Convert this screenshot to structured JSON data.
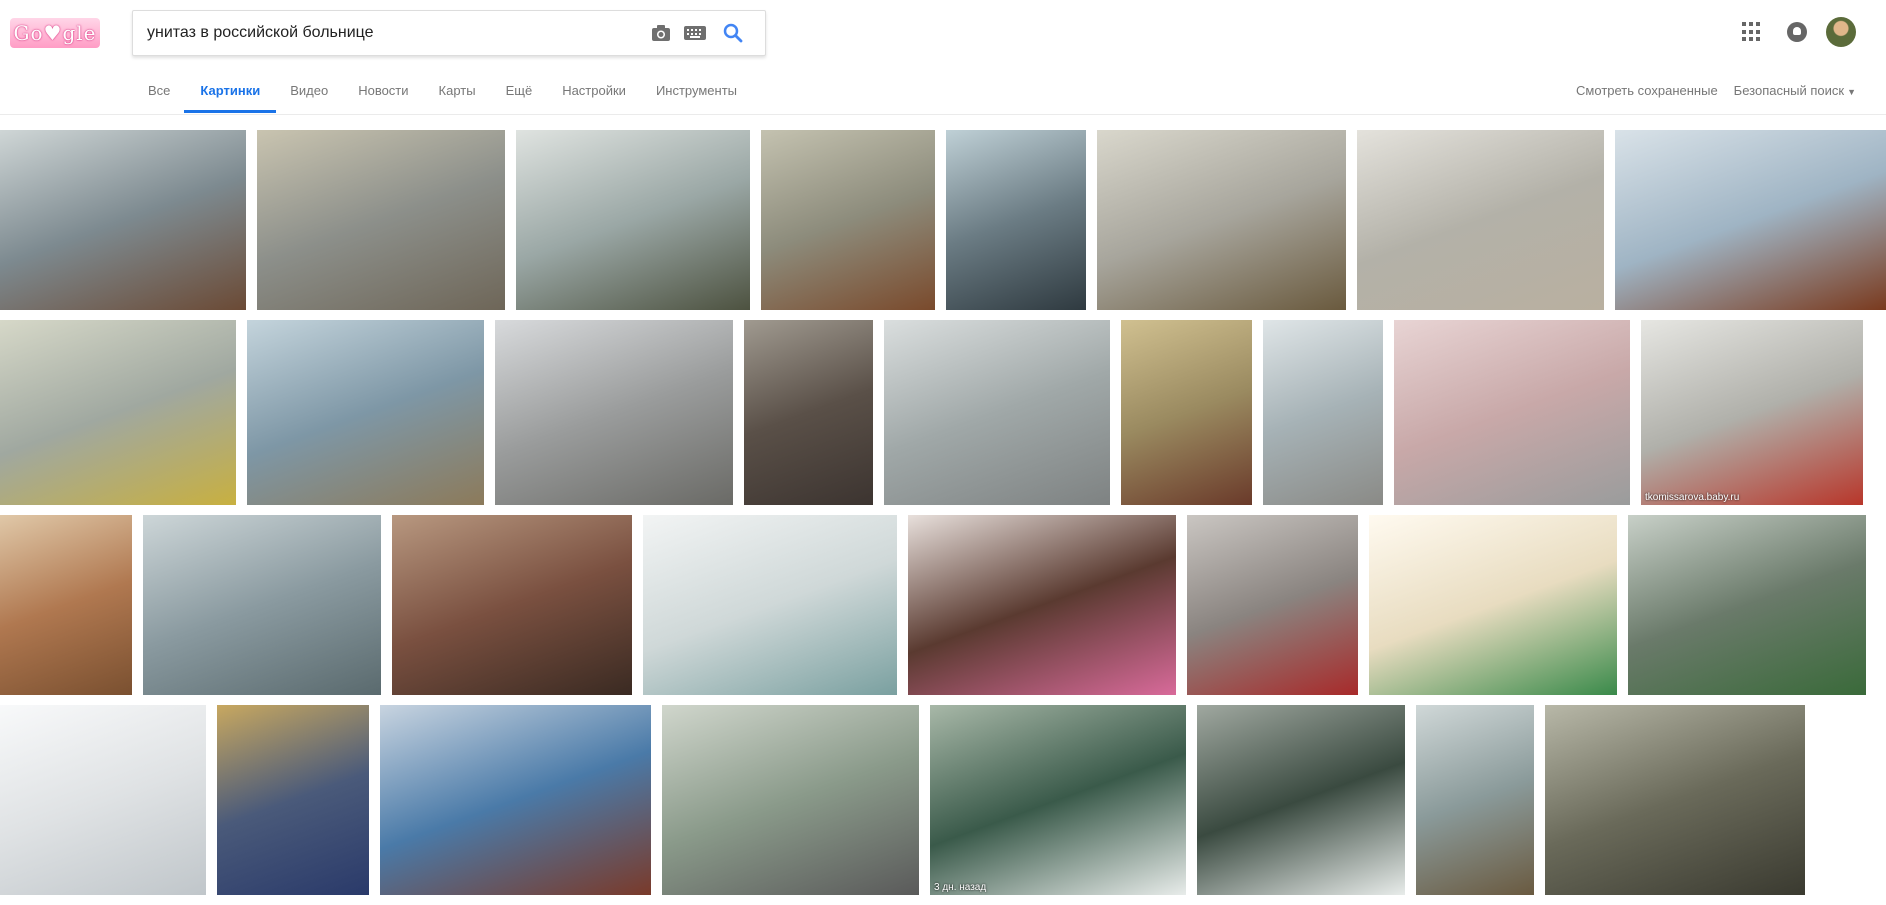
{
  "search": {
    "query": "унитаз в российской больнице"
  },
  "nav": {
    "tabs": [
      "Все",
      "Картинки",
      "Видео",
      "Новости",
      "Карты",
      "Ещё",
      "Настройки",
      "Инструменты"
    ],
    "active": "Картинки",
    "saved": "Смотреть сохраненные",
    "safesearch": "Безопасный поиск"
  },
  "accent_color": "#1a73e8",
  "results": {
    "row1": [
      {
        "colors": [
          "#7d8a90",
          "#cfd6d6",
          "#6b4a35"
        ]
      },
      {
        "colors": [
          "#8c8f8a",
          "#c9c4b0",
          "#6e6658"
        ]
      },
      {
        "colors": [
          "#9aa7a5",
          "#dfe3e0",
          "#4d5240"
        ]
      },
      {
        "colors": [
          "#8d8c7c",
          "#c4c2b0",
          "#7a4a2c"
        ]
      },
      {
        "colors": [
          "#6b7c84",
          "#bfd0d6",
          "#2f3a40"
        ]
      },
      {
        "colors": [
          "#a7a59c",
          "#d9d7cc",
          "#6a5a3e"
        ]
      },
      {
        "colors": [
          "#b3b1a8",
          "#e4e2dc",
          "#b9b0a0"
        ]
      },
      {
        "colors": [
          "#9fb4c4",
          "#d9e2e8",
          "#7a3a1e"
        ]
      }
    ],
    "row2": [
      {
        "colors": [
          "#a0a8a0",
          "#d6d8c8",
          "#c8b040"
        ]
      },
      {
        "colors": [
          "#7e97a6",
          "#c4d4dc",
          "#8c7a5a"
        ]
      },
      {
        "colors": [
          "#9a9c9c",
          "#d8dadc",
          "#6a6a66"
        ]
      },
      {
        "colors": [
          "#5a5048",
          "#a09a90",
          "#3c3430"
        ]
      },
      {
        "colors": [
          "#a0a8a8",
          "#dadede",
          "#7e8282"
        ]
      },
      {
        "colors": [
          "#9a8a60",
          "#d0c090",
          "#6a3a2a"
        ]
      },
      {
        "colors": [
          "#a6b2b6",
          "#dfe5e7",
          "#8a8a86"
        ]
      },
      {
        "colors": [
          "#c8a8a8",
          "#e8d4d4",
          "#9a9c9c"
        ]
      },
      {
        "colors": [
          "#b0b0aa",
          "#e6e6e2",
          "#b8362a"
        ],
        "caption": "tkomissarova.baby.ru"
      }
    ],
    "row3": [
      {
        "colors": [
          "#b07850",
          "#e0c8a8",
          "#7a5030"
        ]
      },
      {
        "colors": [
          "#8a9aa0",
          "#cdd6d8",
          "#5a6a6e"
        ]
      },
      {
        "colors": [
          "#7a5040",
          "#b89880",
          "#3a2a22"
        ]
      },
      {
        "colors": [
          "#cfd8d8",
          "#f2f4f4",
          "#7aa0a0"
        ]
      },
      {
        "colors": [
          "#5a3a30",
          "#e8e0dc",
          "#d86a9a"
        ]
      },
      {
        "colors": [
          "#8a8480",
          "#cac6c2",
          "#a82a2a"
        ]
      },
      {
        "colors": [
          "#e8dcc0",
          "#fffaf0",
          "#3a8a4a"
        ]
      },
      {
        "colors": [
          "#6a7a6a",
          "#c8d0c8",
          "#3a6a3a"
        ]
      }
    ],
    "row4": [
      {
        "colors": [
          "#dfe2e4",
          "#f8f9fa",
          "#c0c6ca"
        ]
      },
      {
        "colors": [
          "#4a5a7a",
          "#c8a860",
          "#2a3a6a"
        ]
      },
      {
        "colors": [
          "#4a7aa8",
          "#c8d4e0",
          "#7a3a2a"
        ]
      },
      {
        "colors": [
          "#8a9a8a",
          "#d0d6cc",
          "#5a5a5a"
        ]
      },
      {
        "colors": [
          "#3a5a4a",
          "#a8b8a8",
          "#e8ecea"
        ],
        "caption": "3 дн. назад"
      },
      {
        "colors": [
          "#3a4a40",
          "#a0a8a0",
          "#e8ecea"
        ]
      },
      {
        "colors": [
          "#8a9a9a",
          "#d0d8d8",
          "#6a5a40"
        ]
      },
      {
        "colors": [
          "#6a6a5a",
          "#b8b8a8",
          "#3a3a30"
        ]
      }
    ]
  }
}
